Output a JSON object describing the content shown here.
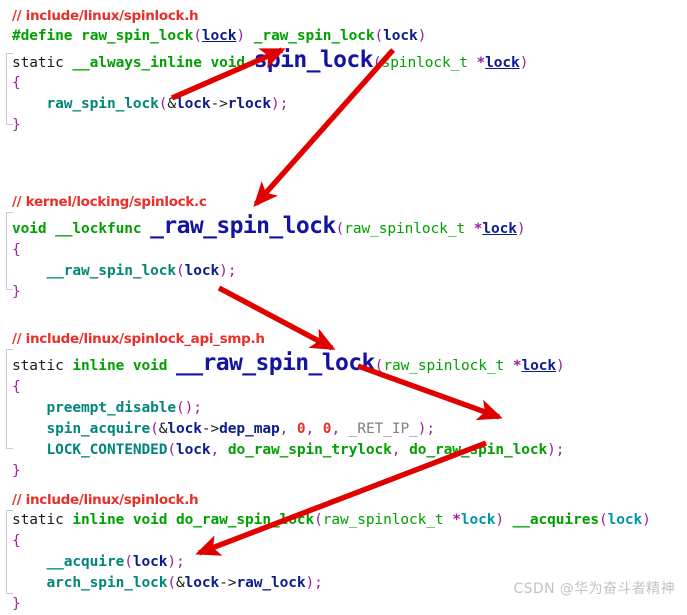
{
  "colors": {
    "background": "#ffffff",
    "comment": "#e8302a",
    "keyword": "#00a000",
    "function": "#00a000",
    "punctuation": "#9b1fa0",
    "identifier": "#0b1a8c",
    "identifier_cyan": "#0096a8",
    "number": "#e8302a",
    "emphasis": "#1414a0",
    "arrow": "#e00000",
    "fold_guide": "#c9c9d6",
    "watermark": "#c3c3c3"
  },
  "watermark": {
    "text": "CSDN @华为奋斗者精神"
  },
  "blocks": [
    {
      "id": "block-spinlock-h-spin-lock",
      "comment": "// include/linux/spinlock.h",
      "lines": [
        "#define raw_spin_lock(lock) _raw_spin_lock(lock)",
        "static __always_inline void spin_lock(spinlock_t *lock)",
        "{",
        "    raw_spin_lock(&lock->rlock);",
        "}"
      ],
      "emphasised_symbol": "spin_lock"
    },
    {
      "id": "block-spinlock-c-raw-spin-lock",
      "comment": "// kernel/locking/spinlock.c",
      "lines": [
        "void __lockfunc _raw_spin_lock(raw_spinlock_t *lock)",
        "{",
        "    __raw_spin_lock(lock);",
        "}"
      ],
      "emphasised_symbol": "_raw_spin_lock"
    },
    {
      "id": "block-spinlock-api-smp-h",
      "comment": "// include/linux/spinlock_api_smp.h",
      "lines": [
        "static inline void __raw_spin_lock(raw_spinlock_t *lock)",
        "{",
        "    preempt_disable();",
        "    spin_acquire(&lock->dep_map, 0, 0, _RET_IP_);",
        "    LOCK_CONTENDED(lock, do_raw_spin_trylock, do_raw_spin_lock);",
        "}"
      ],
      "emphasised_symbol": "__raw_spin_lock"
    },
    {
      "id": "block-spinlock-h-do-raw-spin-lock",
      "comment": "// include/linux/spinlock.h",
      "lines": [
        "static inline void do_raw_spin_lock(raw_spinlock_t *lock) __acquires(lock)",
        "{",
        "    __acquire(lock);",
        "    arch_spin_lock(&lock->raw_lock);",
        "}"
      ],
      "emphasised_symbol": null
    }
  ],
  "arrows": [
    {
      "id": "arrow-rawspinlock-to-define",
      "from": "raw_spin_lock(&lock->rlock)",
      "to": "_raw_spin_lock(lock) in #define"
    },
    {
      "id": "arrow-define-to-raw-spin-lock",
      "from": "_raw_spin_lock(lock) in #define",
      "to": "_raw_spin_lock definition"
    },
    {
      "id": "arrow-rawspinlock-call-to-def",
      "from": "__raw_spin_lock(lock);",
      "to": "__raw_spin_lock definition"
    },
    {
      "id": "arrow-def-to-lock-contended",
      "from": "__raw_spin_lock definition",
      "to": "do_raw_spin_lock in LOCK_CONTENDED"
    },
    {
      "id": "arrow-lock-contended-to-acquire",
      "from": "do_raw_spin_lock in LOCK_CONTENDED",
      "to": "__acquire(lock);"
    }
  ]
}
